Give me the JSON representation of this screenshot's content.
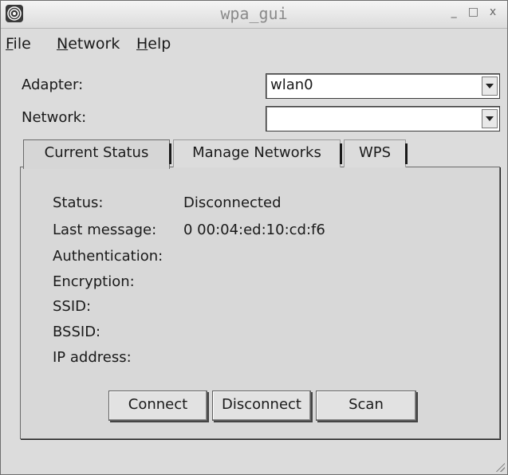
{
  "window": {
    "title": "wpa_gui",
    "app_icon": "wifi-icon",
    "controls": [
      "_",
      "□",
      "x"
    ]
  },
  "menu": {
    "file": {
      "mnemonic": "F",
      "rest": "ile"
    },
    "network": {
      "mnemonic": "N",
      "rest": "etwork"
    },
    "help": {
      "mnemonic": "H",
      "rest": "elp"
    }
  },
  "adapter": {
    "label": "Adapter:",
    "value": "wlan0"
  },
  "network_select": {
    "label": "Network:",
    "value": ""
  },
  "tabs": [
    {
      "label": "Current Status",
      "active": true
    },
    {
      "label": "Manage Networks",
      "active": false
    },
    {
      "label": "WPS",
      "active": false
    }
  ],
  "status": {
    "status_label": "Status:",
    "status_value": "Disconnected",
    "last_message_label": "Last message:",
    "last_message_value": "0 00:04:ed:10:cd:f6",
    "authentication_label": "Authentication:",
    "encryption_label": "Encryption:",
    "ssid_label": "SSID:",
    "bssid_label": "BSSID:",
    "ip_label": "IP address:"
  },
  "buttons": {
    "connect": "Connect",
    "disconnect": "Disconnect",
    "scan": "Scan"
  }
}
